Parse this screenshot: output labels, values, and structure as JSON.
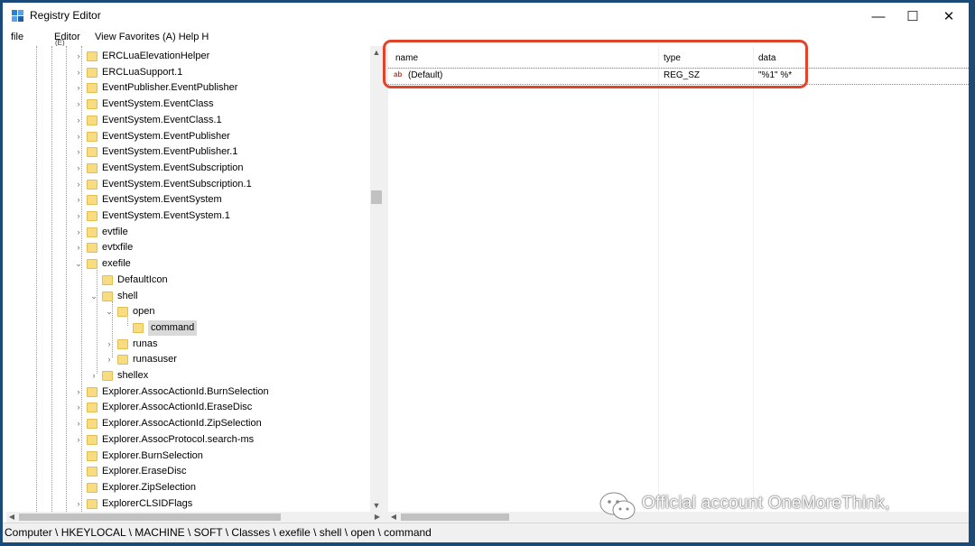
{
  "window": {
    "title": "Registry Editor",
    "minimize": "—",
    "maximize": "☐",
    "close": "✕"
  },
  "menu": {
    "file": "file",
    "edit": "Editor",
    "view_etc": "View Favorites (A) Help H",
    "tiny_label": "(E)"
  },
  "tree": {
    "items": [
      {
        "label": "ERCLuaElevationHelper",
        "chev": "›"
      },
      {
        "label": "ERCLuaSupport.1",
        "chev": "›"
      },
      {
        "label": "EventPublisher.EventPublisher",
        "chev": "›"
      },
      {
        "label": "EventSystem.EventClass",
        "chev": "›"
      },
      {
        "label": "EventSystem.EventClass.1",
        "chev": "›"
      },
      {
        "label": "EventSystem.EventPublisher",
        "chev": "›"
      },
      {
        "label": "EventSystem.EventPublisher.1",
        "chev": "›"
      },
      {
        "label": "EventSystem.EventSubscription",
        "chev": "›"
      },
      {
        "label": "EventSystem.EventSubscription.1",
        "chev": "›"
      },
      {
        "label": "EventSystem.EventSystem",
        "chev": "›"
      },
      {
        "label": "EventSystem.EventSystem.1",
        "chev": "›"
      },
      {
        "label": "evtfile",
        "chev": "›"
      },
      {
        "label": "evtxfile",
        "chev": "›"
      },
      {
        "label": "exefile",
        "chev": "⌄"
      },
      {
        "label": "DefaultIcon",
        "chev": ""
      },
      {
        "label": "shell",
        "chev": "⌄"
      },
      {
        "label": "open",
        "chev": "⌄"
      },
      {
        "label": "command",
        "chev": ""
      },
      {
        "label": "runas",
        "chev": "›"
      },
      {
        "label": "runasuser",
        "chev": "›"
      },
      {
        "label": "shellex",
        "chev": "›"
      },
      {
        "label": "Explorer.AssocActionId.BurnSelection",
        "chev": "›"
      },
      {
        "label": "Explorer.AssocActionId.EraseDisc",
        "chev": "›"
      },
      {
        "label": "Explorer.AssocActionId.ZipSelection",
        "chev": "›"
      },
      {
        "label": "Explorer.AssocProtocol.search-ms",
        "chev": "›"
      },
      {
        "label": "Explorer.BurnSelection",
        "chev": ""
      },
      {
        "label": "Explorer.EraseDisc",
        "chev": ""
      },
      {
        "label": "Explorer.ZipSelection",
        "chev": ""
      },
      {
        "label": "ExplorerCLSIDFlags",
        "chev": "›"
      }
    ],
    "selected": "command"
  },
  "list": {
    "columns": {
      "name": "name",
      "type": "type",
      "data": "data"
    },
    "rows": [
      {
        "icon": "ab",
        "name": "(Default)",
        "type": "REG_SZ",
        "data": "\"%1\" %*"
      }
    ]
  },
  "status": {
    "path": "Computer \\ HKEYLOCAL \\ MACHINE \\ SOFT \\ Classes \\ exefile \\ shell \\ open \\ command"
  },
  "watermark": {
    "text": "Official account OneMoreThink,"
  },
  "colors": {
    "accent_highlight": "#e0442b",
    "folder": "#f7dc81",
    "background": "#1a4a7a"
  }
}
